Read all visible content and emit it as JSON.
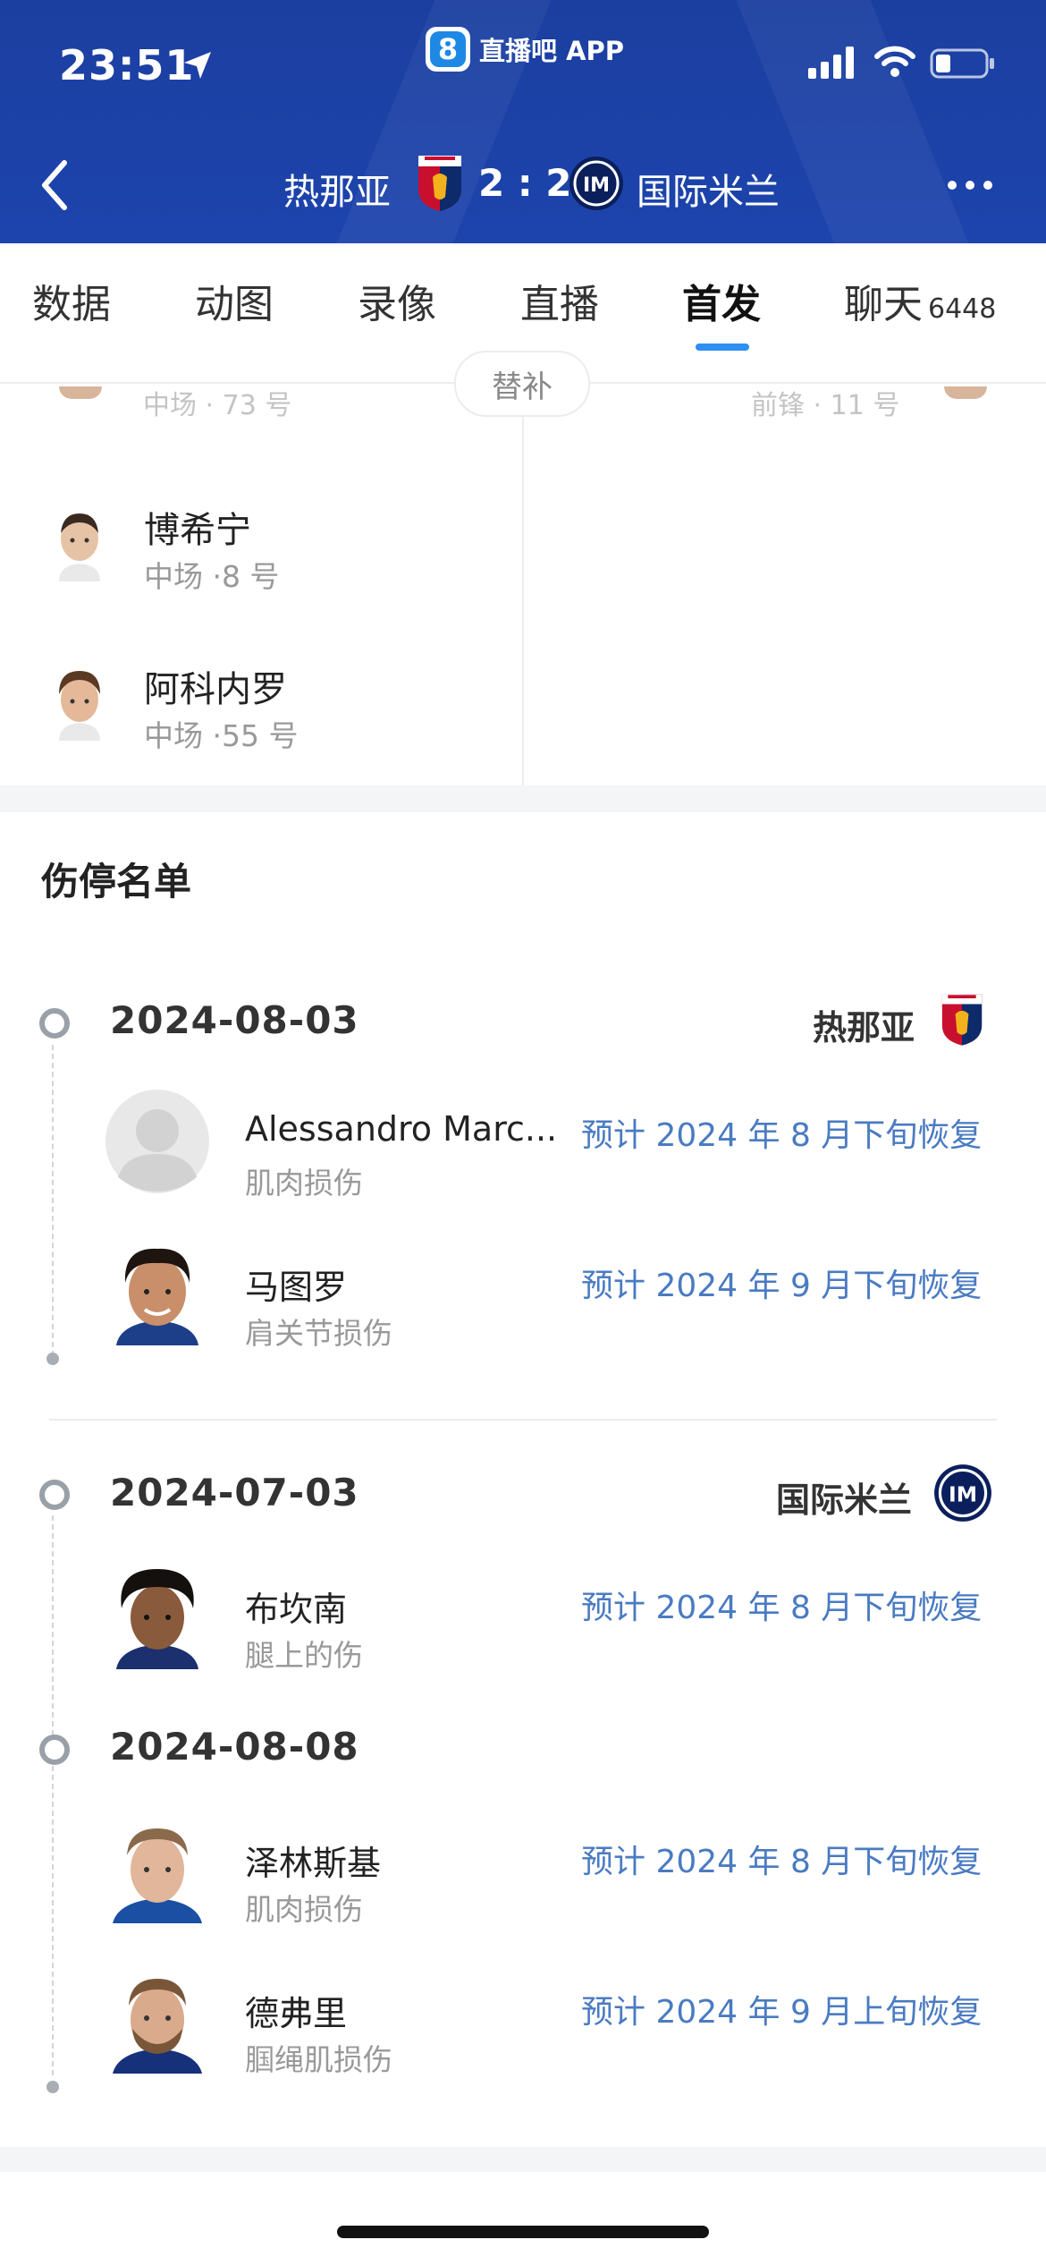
{
  "status": {
    "time": "23:51"
  },
  "app": {
    "logo_text": "8",
    "name": "直播吧 APP"
  },
  "match": {
    "home": "热那亚",
    "away": "国际米兰",
    "score": "2 : 2",
    "colors": {
      "header": "#1d44ad",
      "accent": "#2e8ff0"
    }
  },
  "tabs": [
    {
      "label": "数据"
    },
    {
      "label": "动图"
    },
    {
      "label": "录像"
    },
    {
      "label": "直播"
    },
    {
      "label": "首发",
      "active": true
    },
    {
      "label": "聊天",
      "count": "6448"
    }
  ],
  "lineup": {
    "sub_label": "替补",
    "faded_left": "中场 · 73 号",
    "faded_right": "前锋 · 11 号",
    "players": [
      {
        "name": "博希宁",
        "pos": "中场 ·8 号"
      },
      {
        "name": "阿科内罗",
        "pos": "中场 ·55 号"
      }
    ]
  },
  "injury": {
    "title": "伤停名单",
    "groups": [
      {
        "date": "2024-08-03",
        "team": "热那亚",
        "players": [
          {
            "name": "Alessandro Marc...",
            "type": "肌肉损伤",
            "recovery": "预计 2024 年 8 月下旬恢复"
          },
          {
            "name": "马图罗",
            "type": "肩关节损伤",
            "recovery": "预计 2024 年 9 月下旬恢复"
          }
        ]
      },
      {
        "date": "2024-07-03",
        "team": "国际米兰",
        "players": [
          {
            "name": "布坎南",
            "type": "腿上的伤",
            "recovery": "预计 2024 年 8 月下旬恢复"
          }
        ]
      },
      {
        "date": "2024-08-08",
        "team": "",
        "players": [
          {
            "name": "泽林斯基",
            "type": "肌肉损伤",
            "recovery": "预计 2024 年 8 月下旬恢复"
          },
          {
            "name": "德弗里",
            "type": "腘绳肌损伤",
            "recovery": "预计 2024 年 9 月上旬恢复"
          }
        ]
      }
    ]
  }
}
